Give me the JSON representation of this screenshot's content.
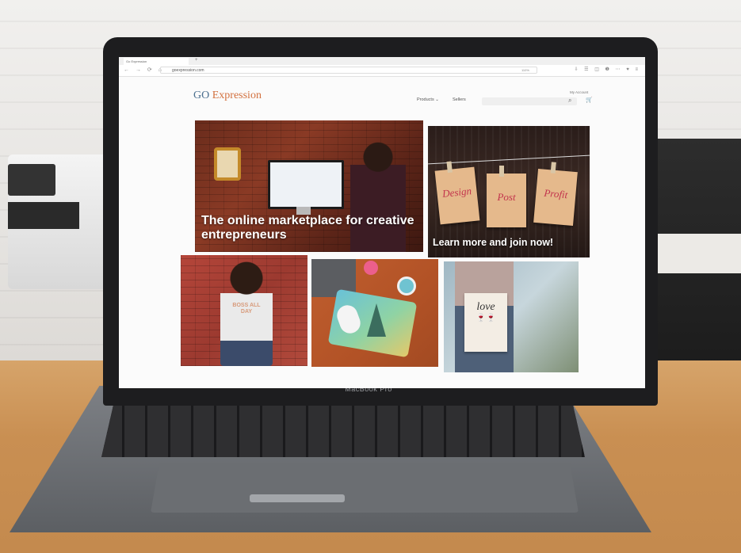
{
  "browser": {
    "tab_title": "Go Expression",
    "url": "goexpression.com",
    "zoom": "110%",
    "nav_icons": "← → ⟳ ⌂",
    "tool_icons": "⇩ ☰ ◫ ❶ ⋯ ♥ ≡",
    "new_tab_icon": "+"
  },
  "site": {
    "logo_go": "GO",
    "logo_expression": "Expression",
    "nav": {
      "products": "Products ⌄",
      "sellers": "Sellers"
    },
    "my_account": "My Account",
    "search_icon": "⌕",
    "cart_icon": "🛒"
  },
  "hero": {
    "main_title": "The online marketplace for creative entrepreneurs",
    "side_title": "Learn more and join now!",
    "bags": [
      "Design",
      "Post",
      "Profit"
    ]
  },
  "tiles": {
    "shirt_text": "BOSS ALL DAY",
    "tote_word": "love",
    "tote_glasses": "🍷🍷"
  },
  "device": {
    "label": "MacBook Pro"
  },
  "colors": {
    "logo_go": "#4b6f8f",
    "logo_expression": "#d2703e",
    "bag_text": "#c2334c"
  }
}
